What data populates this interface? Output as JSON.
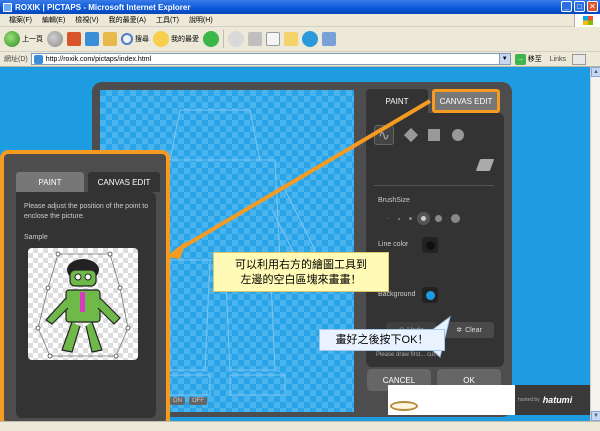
{
  "window": {
    "title": "ROXIK | PICTAPS - Microsoft Internet Explorer",
    "minimize": "_",
    "maximize": "□",
    "close": "✕"
  },
  "menu": {
    "items": [
      "檔案(F)",
      "編輯(E)",
      "檢視(V)",
      "我的最愛(A)",
      "工具(T)",
      "說明(H)"
    ]
  },
  "toolbar": {
    "back_label": "上一頁",
    "search_label": "搜尋",
    "favorites_label": "我的最愛"
  },
  "address": {
    "label": "網址(D)",
    "url": "http://roxik.com/pictaps/index.html",
    "go_label": "移至",
    "links_label": "Links"
  },
  "app": {
    "right_tabs": {
      "paint": "PAINT",
      "canvas_edit": "CANVAS EDIT"
    },
    "brush_size_label": "BrushSize",
    "line_color_label": "Line color",
    "background_label": "Background",
    "undo_label": "Undo",
    "clear_label": "Clear",
    "hint_text": "Please draw first... cut.",
    "cancel_label": "CANCEL",
    "ok_label": "OK",
    "bottom_controls": [
      "ON",
      "OFF"
    ],
    "powered_by_label": "hosted by",
    "powered_by_brand": "hatumi"
  },
  "zoom_panel": {
    "tabs": {
      "paint": "PAINT",
      "canvas_edit": "CANVAS EDIT"
    },
    "description": "Please adjust the position of the point to enclose the picture.",
    "sample_label": "Sample"
  },
  "callouts": {
    "main_line1": "可以利用右方的繪圖工具到",
    "main_line2": "左邊的空白區塊來畫畫！",
    "ok_hint": "畫好之後按下OK！"
  },
  "colors": {
    "accent_orange": "#f59b22",
    "page_background": "#1e9ce2",
    "line_color_swatch": "#111111",
    "background_swatch": "#1e9ce2"
  }
}
